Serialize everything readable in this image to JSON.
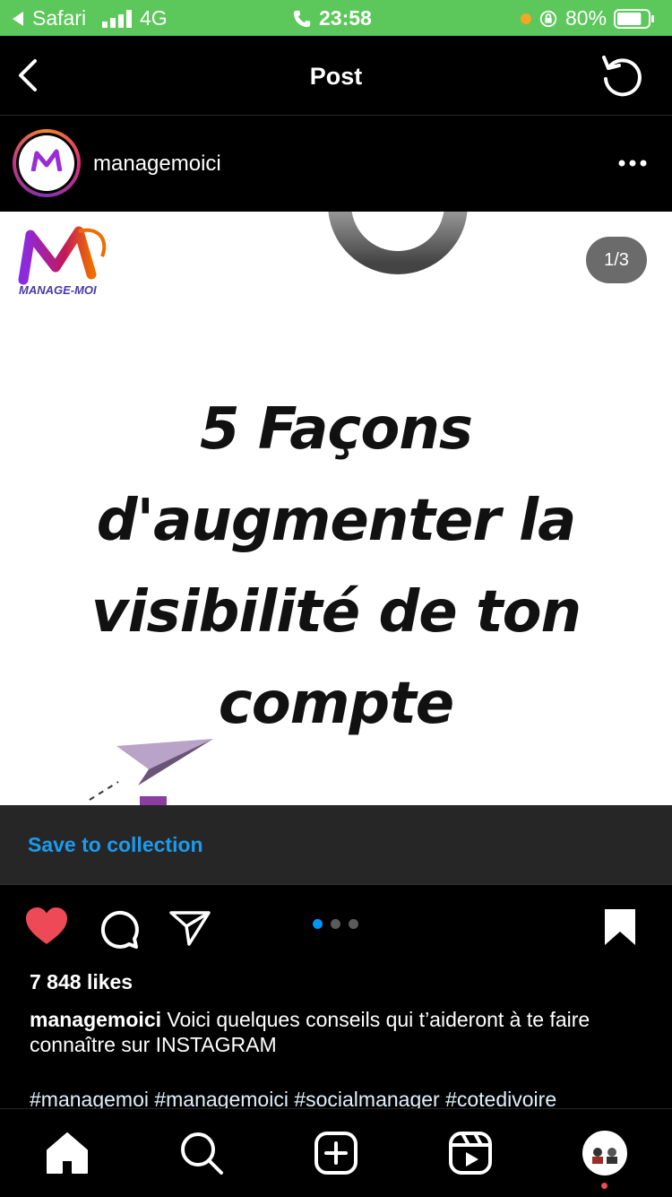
{
  "status_bar": {
    "back_app": "Safari",
    "network": "4G",
    "time": "23:58",
    "battery": "80%",
    "battery_level": 0.8
  },
  "nav": {
    "title": "Post",
    "back_icon": "chevron-left-icon",
    "refresh_icon": "refresh-icon"
  },
  "post": {
    "username": "managemoici",
    "more_icon": "more-horizontal-icon",
    "image": {
      "logo_text": "MANAGE-MOI",
      "headline": [
        "5 Façons",
        "d'augmenter la",
        "visibilité de ton",
        "compte"
      ],
      "counter": "1/3"
    },
    "save_to_collection": "Save to collection",
    "carousel": {
      "count": 3,
      "active_index": 0
    },
    "likes": "7 848 likes",
    "caption_user": "managemoici",
    "caption_text": " Voici quelques conseils qui t’aideront à te faire connaître sur INSTAGRAM",
    "hashtags": "#managemoi #managemoici #socialmanager #cotedivoire"
  },
  "tab_bar": {
    "items": [
      "home-icon",
      "search-icon",
      "new-post-icon",
      "reels-icon",
      "profile-avatar"
    ]
  },
  "colors": {
    "status_bar": "#5cc75a",
    "link": "#1a9bf0",
    "like": "#ed4956",
    "background": "#000000"
  }
}
